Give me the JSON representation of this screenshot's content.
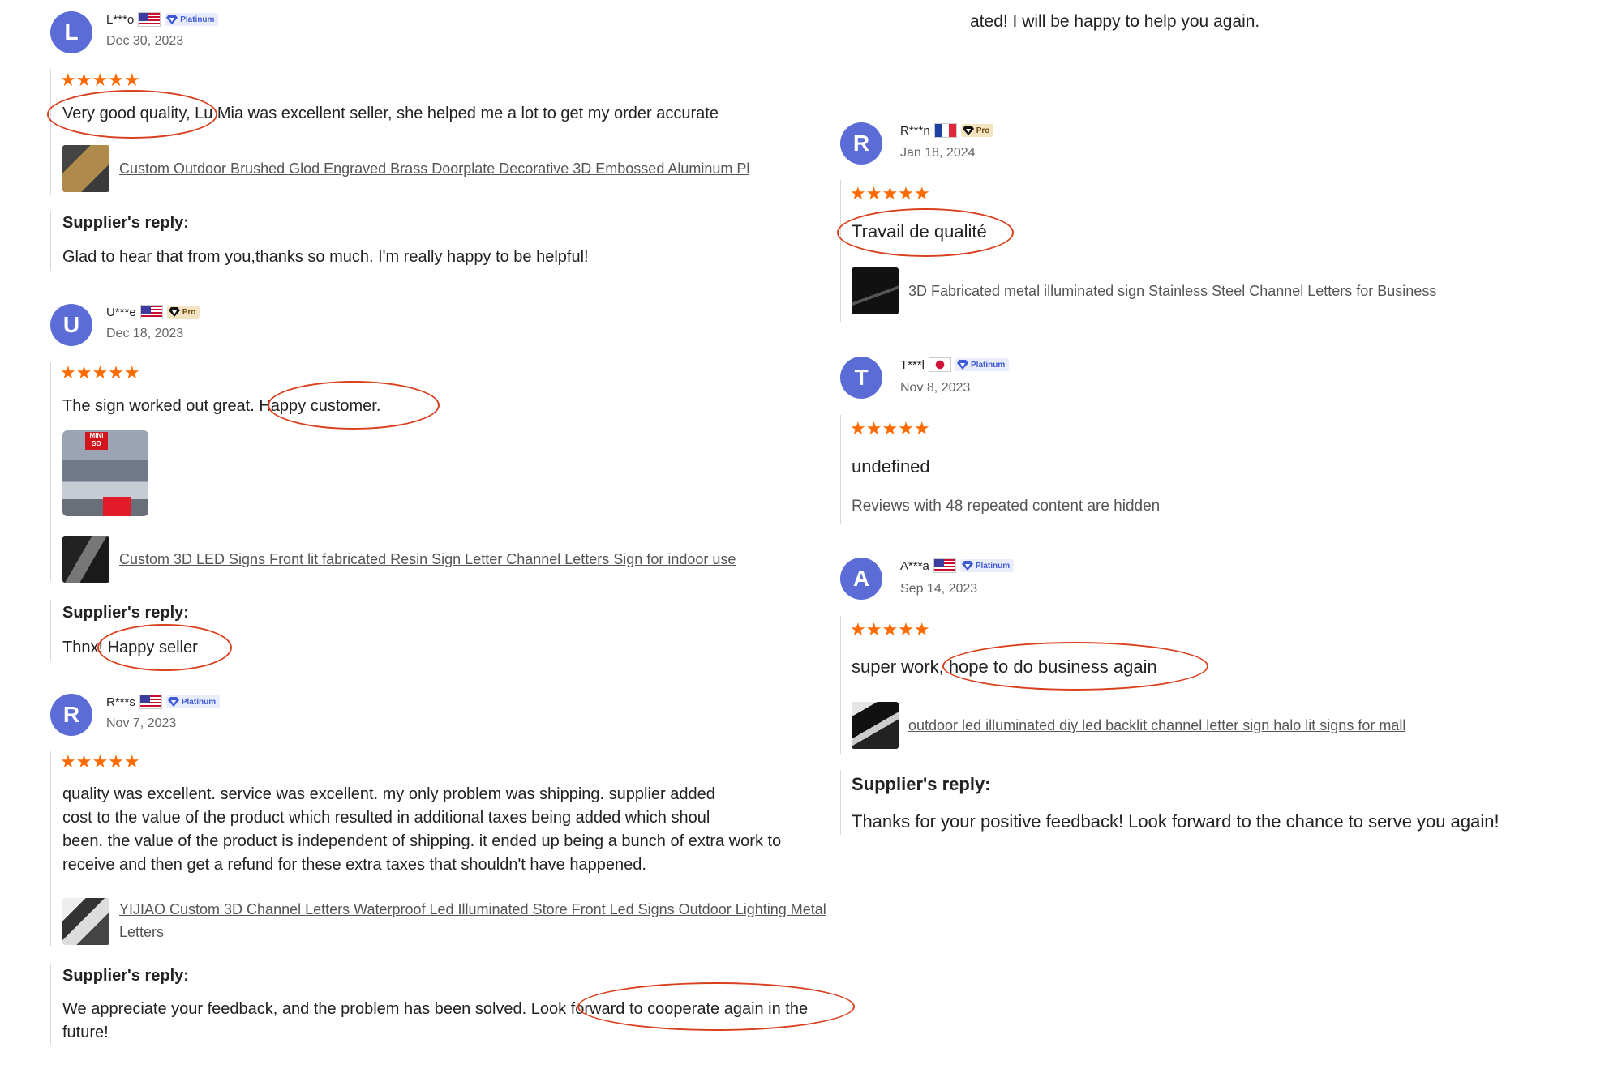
{
  "top_fragment": "ated! I will be happy to help you again.",
  "labels": {
    "supplier_reply": "Supplier's reply:"
  },
  "badges": {
    "platinum": "Platinum",
    "pro": "Pro"
  },
  "colors": {
    "star": "#ff6a00",
    "avatar": "#5b6cd6",
    "highlight_oval": "#d9401e",
    "badge_platinum": "#3e5ad8"
  },
  "reviews": [
    {
      "initial": "L",
      "user": "L***o",
      "flag": "us-flag-icon",
      "badge": "platinum",
      "date": "Dec 30, 2023",
      "rating": 5,
      "text": "Very good quality, Lu Mia was excellent seller, she helped me a lot to get my order accurate",
      "product": "Custom Outdoor Brushed Glod Engraved Brass Doorplate Decorative 3D Embossed Aluminum Pl",
      "reply": "Glad to hear that from you,thanks so much. I'm really happy to be helpful!"
    },
    {
      "initial": "U",
      "user": "U***e",
      "flag": "us-flag-icon",
      "badge": "pro",
      "date": "Dec 18, 2023",
      "rating": 5,
      "text": "The sign worked out great. Happy customer.",
      "photo_sign_text": "MINI SO",
      "product": "Custom 3D LED Signs Front lit fabricated Resin Sign Letter Channel Letters Sign for indoor use",
      "reply": "Thnx! Happy seller"
    },
    {
      "initial": "R",
      "user": "R***s",
      "flag": "us-flag-icon",
      "badge": "platinum",
      "date": "Nov 7, 2023",
      "rating": 5,
      "text_lines": [
        "quality was excellent. service was excellent. my only problem was shipping. supplier added",
        "cost to the value of the product which resulted in additional taxes being added which shoul",
        "been. the value of the product is independent of shipping. it ended up being a bunch of extra work to",
        "receive and then get a refund for these extra taxes that shouldn't have happened."
      ],
      "product_lines": [
        "YIJIAO Custom 3D Channel Letters Waterproof Led Illuminated Store Front Led Signs Outdoor Lighting Metal",
        "Letters"
      ],
      "reply_lines": [
        "We appreciate your feedback, and the problem has been solved. Look forward to cooperate again in the",
        "future!"
      ]
    },
    {
      "initial": "R",
      "user": "R***n",
      "flag": "fr-flag-icon",
      "badge": "pro",
      "date": "Jan 18, 2024",
      "rating": 5,
      "text": "Travail de qualité",
      "product": "3D Fabricated metal illuminated sign Stainless Steel Channel Letters for Business"
    },
    {
      "initial": "T",
      "user": "T***l",
      "flag": "jp-flag-icon",
      "badge": "platinum",
      "date": "Nov 8, 2023",
      "rating": 5,
      "text": "undefined",
      "hidden_note": "Reviews with 48 repeated content are hidden"
    },
    {
      "initial": "A",
      "user": "A***a",
      "flag": "us-flag-icon",
      "badge": "platinum",
      "date": "Sep 14, 2023",
      "rating": 5,
      "text": "super work, hope to do business again",
      "product": "outdoor led illuminated diy led backlit channel letter sign halo lit signs for mall",
      "reply": "Thanks for your positive feedback! Look forward to the chance to serve you again!"
    }
  ]
}
